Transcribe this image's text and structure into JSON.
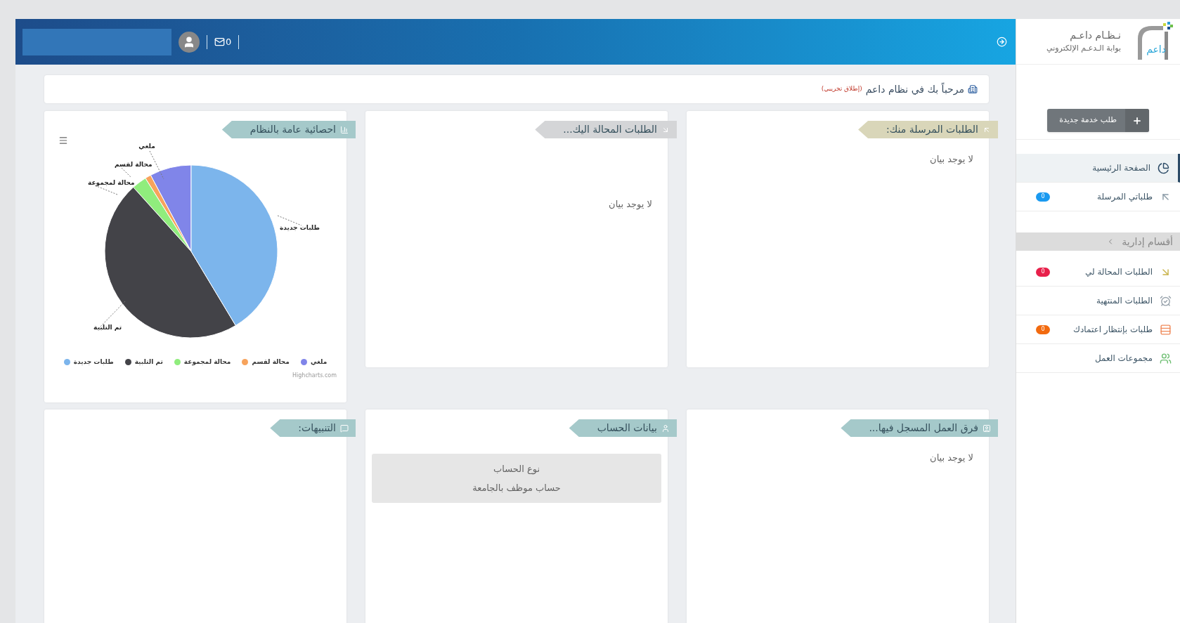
{
  "header": {
    "mail_count": "0"
  },
  "logo": {
    "title": "نـظـام داعـم",
    "subtitle": "بوابة الـدعـم الإلكتروني",
    "mark": "داعم"
  },
  "new_request_button": {
    "label": "طلب خدمة جديدة"
  },
  "nav": [
    {
      "kind": "item",
      "label": "الصفحة الرئيسية",
      "selected": true
    },
    {
      "kind": "item",
      "label": "طلباتي المرسلة",
      "selected": false,
      "badge": "0",
      "color": "#1a9af0"
    },
    {
      "kind": "group",
      "label": "أقسام إدارية"
    },
    {
      "kind": "item",
      "label": "الطلبات المحالة لي",
      "selected": false,
      "badge": "0",
      "color": "#e8204a"
    },
    {
      "kind": "item",
      "label": "الطلبات المنتهية",
      "selected": false
    },
    {
      "kind": "item",
      "label": "طلبات بإنتظار اعتمادك",
      "selected": false,
      "badge": "0",
      "color": "#f26a0f"
    },
    {
      "kind": "item",
      "label": "مجموعات العمل",
      "selected": false
    }
  ],
  "welcome": {
    "text": "مرحباً بك في نظام داعم",
    "tag": "(إطلاق تجريبي)"
  },
  "cards": [
    {
      "kind": "text",
      "title": "الطلبات المرسلة منك:",
      "color": "#d9d6b9",
      "body": "لا يوجد بيان"
    },
    {
      "kind": "text",
      "title": "الطلبات المحالة اليك...",
      "color": "#d4d5d7",
      "body": "لا يوجد بيان"
    },
    {
      "kind": "chart",
      "title": "احصائية عامة بالنظام",
      "color": "#a5c9ca",
      "credit": "Highcharts.com",
      "series": [
        {
          "slice_label": "ملغي",
          "legend_label": "ملغي",
          "color": "#8085e9"
        },
        {
          "slice_label": "محالة لقسم",
          "legend_label": "محالة لقسم",
          "color": "#f7a35c"
        },
        {
          "slice_label": "محالة لمجموعة",
          "legend_label": "محالة لمجموعة",
          "color": "#90ed7d"
        },
        {
          "slice_label": "تم التلبية",
          "legend_label": "تم التلبية",
          "color": "#434348"
        },
        {
          "slice_label": "طلبات جديدة",
          "legend_label": "طلبات جديدة",
          "color": "#7cb5ec"
        }
      ]
    },
    {
      "kind": "text",
      "title": "فرق العمل المسجل فيها...",
      "color": "#a5c9ca",
      "body": "لا يوجد بيان"
    },
    {
      "kind": "account",
      "title": "بيانات الحساب",
      "color": "#a5c9ca",
      "account": {
        "label": "نوع الحساب",
        "value": "حساب موظف بالجامعة"
      }
    },
    {
      "kind": "empty",
      "title": "التنبيهات:",
      "color": "#a5c9ca"
    }
  ]
}
